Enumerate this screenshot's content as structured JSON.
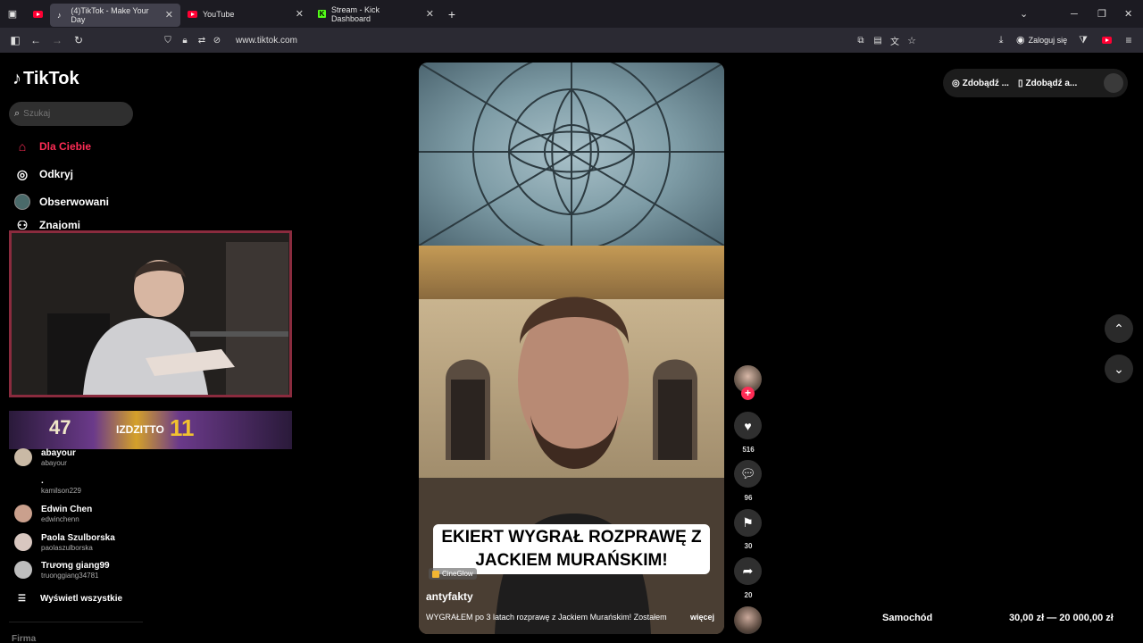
{
  "browser": {
    "tabs": [
      {
        "title": "(4)TikTok - Make Your Day",
        "active": true,
        "icon": "tiktok-icon"
      },
      {
        "title": "YouTube",
        "active": false,
        "icon": "youtube-icon"
      },
      {
        "title": "Stream - Kick Dashboard",
        "active": false,
        "icon": "kick-icon"
      }
    ],
    "url": "www.tiktok.com",
    "login_label": "Zaloguj się"
  },
  "sidebar": {
    "logo": "TikTok",
    "search_placeholder": "Szukaj",
    "items": [
      {
        "label": "Dla Ciebie",
        "icon": "home-icon",
        "active": true
      },
      {
        "label": "Odkryj",
        "icon": "compass-icon",
        "active": false
      },
      {
        "label": "Obserwowani",
        "icon": "following-avatar-icon",
        "active": false
      },
      {
        "label": "Znajomi",
        "icon": "friends-icon",
        "active": false
      }
    ],
    "following": [
      {
        "name": "abayour",
        "handle": "abayour"
      },
      {
        "name": ".",
        "handle": "kamilson229"
      },
      {
        "name": "Edwin Chen",
        "handle": "edwinchenn"
      },
      {
        "name": "Paola Szulborska",
        "handle": "paolaszulborska"
      },
      {
        "name": "Trương giang99",
        "handle": "truonggiang34781"
      }
    ],
    "see_all": "Wyświetl wszystkie",
    "footer_heading": "Firma"
  },
  "banner": {
    "text_left": "47",
    "text_mid": "IZDZITTO",
    "text_right": "11"
  },
  "video": {
    "caption": "EKIERT WYGRAŁ ROZPRAWĘ Z JACKIEM MURAŃSKIM!",
    "effect": "CineGlow",
    "author": "antyfakty",
    "description": "WYGRAŁEM po 3 latach rozprawę z Jackiem Murańskim! Zostałem",
    "more": "więcej"
  },
  "actions": {
    "likes": "516",
    "comments": "96",
    "saves": "30",
    "shares": "20"
  },
  "top_bar": {
    "coins_label": "Zdobądź ...",
    "app_label": "Zdobądź a..."
  },
  "ad": {
    "label": "Samochód",
    "price": "30,00 zł — 20 000,00 zł"
  },
  "colors": {
    "accent": "#fe2c55",
    "background": "#000000",
    "browser_chrome": "#2b2a33"
  }
}
